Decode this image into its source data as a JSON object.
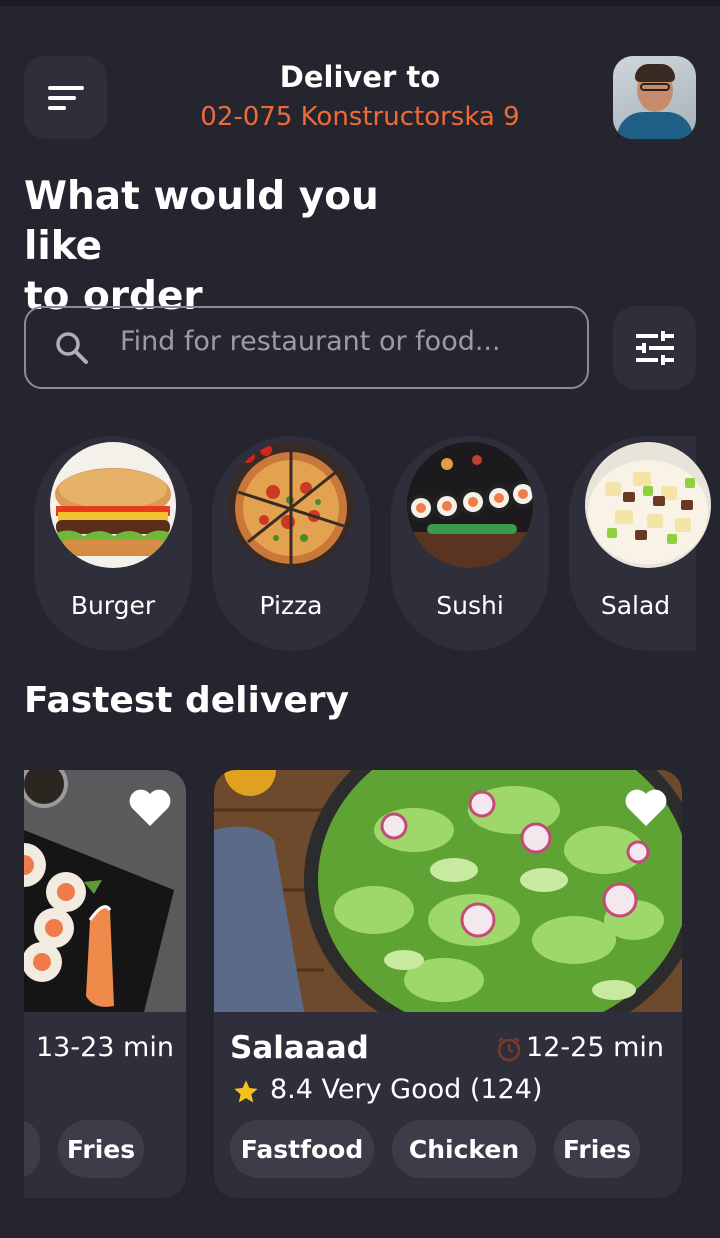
{
  "header": {
    "deliver_label": "Deliver to",
    "address": "02-075 Konstructorska 9"
  },
  "headline": {
    "line1": "What would you like",
    "line2": "to order"
  },
  "search": {
    "placeholder": "Find for restaurant or food..."
  },
  "categories": [
    {
      "label": "Burger",
      "icon": "burger-image"
    },
    {
      "label": "Pizza",
      "icon": "pizza-image"
    },
    {
      "label": "Sushi",
      "icon": "sushi-image"
    },
    {
      "label": "Salad",
      "icon": "salad-image"
    }
  ],
  "section": {
    "title": "Fastest delivery"
  },
  "restaurants": [
    {
      "time": "13-23 min",
      "tags": [
        "",
        "Fries"
      ]
    },
    {
      "name": "Salaaad",
      "time": "12-25 min",
      "rating": "8.4 Very Good (124)",
      "tags": [
        "Fastfood",
        "Chicken",
        "Fries"
      ]
    }
  ],
  "colors": {
    "background": "#25252f",
    "surface": "#2f2f3b",
    "accent": "#ee6a38",
    "star": "#f7c21e"
  }
}
